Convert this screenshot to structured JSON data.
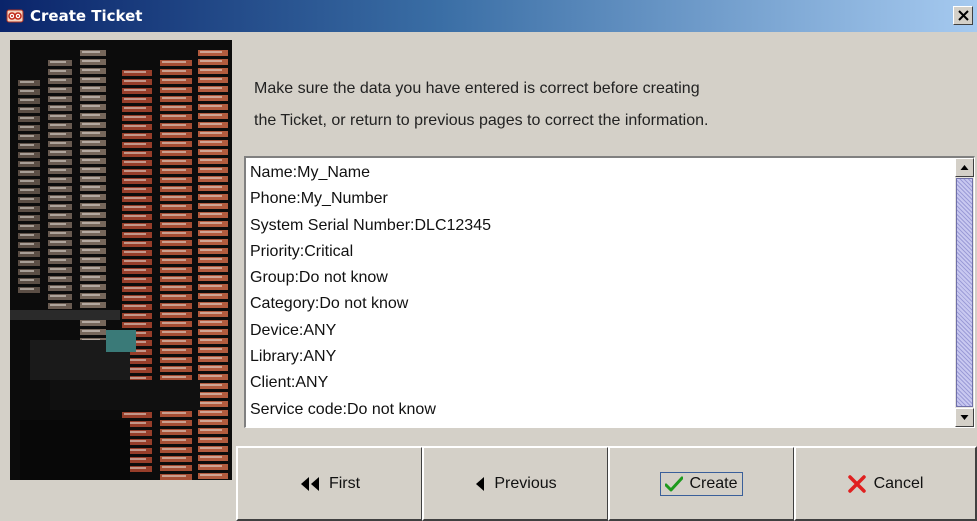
{
  "window": {
    "title": "Create Ticket",
    "icon": "app-tape-icon",
    "close_icon": "close-icon"
  },
  "instructions": {
    "line1": "Make sure the data you have entered is correct before creating",
    "line2": "the Ticket, or return to previous pages to correct the information."
  },
  "summary": {
    "lines": [
      "Name:My_Name",
      "Phone:My_Number",
      "System Serial Number:DLC12345",
      "Priority:Critical",
      "Group:Do not know",
      "Category:Do not know",
      "Device:ANY",
      "Library:ANY",
      "Client:ANY",
      "Service code:Do not know"
    ],
    "scroll_position": 0.0
  },
  "buttons": {
    "first": {
      "label": "First",
      "icon": "double-left-arrow-icon"
    },
    "previous": {
      "label": "Previous",
      "icon": "left-arrow-icon"
    },
    "create": {
      "label": "Create",
      "icon": "checkmark-icon",
      "focused": true
    },
    "cancel": {
      "label": "Cancel",
      "icon": "red-x-icon"
    }
  },
  "colors": {
    "titlebar_start": "#0a246a",
    "titlebar_end": "#a6caf0",
    "scroll_thumb": "#b4b4e6",
    "check_green": "#1e9a1e",
    "cancel_red": "#e02020"
  }
}
